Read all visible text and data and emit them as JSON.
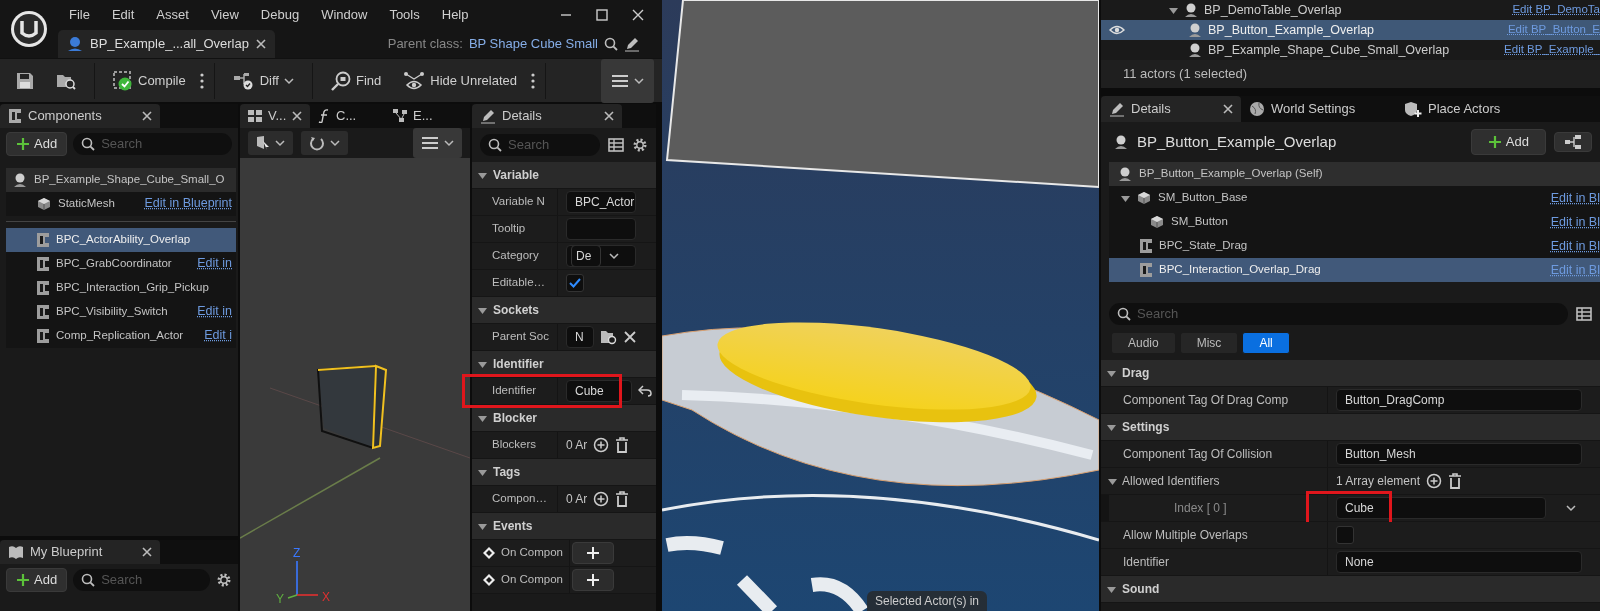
{
  "editor": {
    "menu": [
      "File",
      "Edit",
      "Asset",
      "View",
      "Debug",
      "Window",
      "Tools",
      "Help"
    ],
    "asset_tab": {
      "label": "BP_Example_...all_Overlap",
      "selected": true
    },
    "parent_class": {
      "label": "Parent class:",
      "value": "BP Shape Cube Small"
    },
    "toolbar": [
      {
        "kind": "icon"
      },
      {
        "kind": "icon"
      },
      {
        "kind": "text",
        "label": "Compile"
      },
      {
        "kind": "more"
      },
      {
        "kind": "text",
        "label": "Diff"
      },
      {
        "kind": "text",
        "label": "Find"
      },
      {
        "kind": "text",
        "label": "Hide Unrelated"
      },
      {
        "kind": "more"
      },
      {
        "kind": "menu"
      }
    ],
    "components": {
      "title": "Components",
      "add": "Add",
      "search_placeholder": "Search",
      "items": [
        {
          "kind": "actor",
          "label": "BP_Example_Shape_Cube_Small_O",
          "selected": false,
          "children": [
            {
              "kind": "mesh",
              "label": "StaticMesh",
              "link": "Edit in Blueprint",
              "selected": false
            }
          ]
        },
        {
          "kind": "component",
          "label": "BPC_ActorAbility_Overlap",
          "selected": true
        },
        {
          "kind": "component",
          "label": "BPC_GrabCoordinator",
          "link": "Edit in",
          "selected": false
        },
        {
          "kind": "component",
          "label": "BPC_Interaction_Grip_Pickup",
          "selected": false
        },
        {
          "kind": "component",
          "label": "BPC_Visibility_Switch",
          "link": "Edit in",
          "selected": false
        },
        {
          "kind": "component",
          "label": "Comp_Replication_Actor",
          "link": "Edit i",
          "selected": false
        }
      ]
    },
    "viewport": {
      "tabs": [
        {
          "label": "V...",
          "selected": true
        },
        {
          "label": "C...",
          "selected": false
        },
        {
          "label": "E...",
          "selected": false
        }
      ],
      "axes": [
        "Z",
        "Y",
        "X"
      ]
    },
    "my_blueprint": {
      "title": "My Blueprint",
      "add": "Add",
      "search_placeholder": "Search"
    },
    "details": {
      "title": "Details",
      "search_placeholder": "Search",
      "sections": [
        {
          "title": "Variable",
          "expanded": true,
          "rows": [
            {
              "kind": "text",
              "label": "Variable N",
              "value": "BPC_Actor"
            },
            {
              "kind": "text",
              "label": "Tooltip"
            },
            {
              "kind": "combo",
              "label": "Category",
              "value": "De"
            },
            {
              "kind": "check",
              "label": "Editable…",
              "checked": true
            }
          ]
        },
        {
          "title": "Sockets",
          "expanded": true,
          "rows": [
            {
              "kind": "socket",
              "label": "Parent Soc",
              "value": "N"
            }
          ]
        },
        {
          "title": "Identifier",
          "expanded": true,
          "rows": [
            {
              "kind": "text",
              "label": "Identifier",
              "value": "Cube",
              "highlighted": true,
              "resettable": true
            }
          ]
        },
        {
          "title": "Blocker",
          "expanded": true,
          "rows": [
            {
              "kind": "array",
              "label": "Blockers",
              "value": "0 Ar"
            }
          ]
        },
        {
          "title": "Tags",
          "expanded": true,
          "rows": [
            {
              "kind": "array",
              "label": "Compon…",
              "value": "0 Ar"
            }
          ]
        },
        {
          "title": "Events",
          "expanded": true,
          "rows": [
            {
              "kind": "event",
              "label": "On Compon"
            },
            {
              "kind": "event",
              "label": "On Compon"
            }
          ]
        }
      ]
    }
  },
  "scene": {
    "overlay_text": "Selected Actor(s) in"
  },
  "outliner": {
    "items": [
      {
        "label": "BP_DemoTable_Overlap",
        "link": "Edit BP_DemoTa",
        "expanded": true,
        "selected": false,
        "children": [
          {
            "label": "BP_Button_Example_Overlap",
            "link": "Edit BP_Button_E",
            "selected": true
          },
          {
            "label": "BP_Example_Shape_Cube_Small_Overlap",
            "link": "Edit BP_Example_",
            "selected": false
          }
        ]
      }
    ],
    "status": "11 actors (1 selected)"
  },
  "level_details": {
    "tabs": [
      {
        "label": "Details",
        "selected": true
      },
      {
        "label": "World Settings",
        "selected": false
      },
      {
        "label": "Place Actors",
        "selected": false
      }
    ],
    "actor_name": "BP_Button_Example_Overlap",
    "add": "Add",
    "components": [
      {
        "kind": "actor",
        "label": "BP_Button_Example_Overlap (Self)",
        "selected": false
      },
      {
        "kind": "mesh",
        "label": "SM_Button_Base",
        "expanded": true,
        "selected": false,
        "link": "Edit in Bl",
        "children": [
          {
            "kind": "mesh",
            "label": "SM_Button",
            "link": "Edit in Bl",
            "selected": false
          }
        ]
      },
      {
        "kind": "component",
        "label": "BPC_State_Drag",
        "link": "Edit in Bl",
        "selected": false
      },
      {
        "kind": "component",
        "label": "BPC_Interaction_Overlap_Drag",
        "link": "Edit in Bl",
        "selected": true
      }
    ],
    "search_placeholder": "Search",
    "filters": [
      {
        "label": "Audio",
        "selected": false
      },
      {
        "label": "Misc",
        "selected": false
      },
      {
        "label": "All",
        "selected": true
      }
    ],
    "sections": [
      {
        "title": "Drag",
        "expanded": true,
        "rows": [
          {
            "kind": "text",
            "label": "Component Tag Of Drag Comp",
            "value": "Button_DragComp"
          }
        ]
      },
      {
        "title": "Settings",
        "expanded": true,
        "rows": [
          {
            "kind": "text",
            "label": "Component Tag Of Collision",
            "value": "Button_Mesh"
          },
          {
            "kind": "array",
            "label": "Allowed Identifiers",
            "value": "1 Array element",
            "expanded": true,
            "children": [
              {
                "kind": "select",
                "label": "Index [ 0 ]",
                "value": "Cube",
                "highlighted": true
              }
            ]
          },
          {
            "kind": "check",
            "label": "Allow Multiple Overlaps",
            "checked": false
          },
          {
            "kind": "text",
            "label": "Identifier",
            "value": "None"
          }
        ]
      },
      {
        "title": "Sound",
        "expanded": true
      }
    ]
  }
}
